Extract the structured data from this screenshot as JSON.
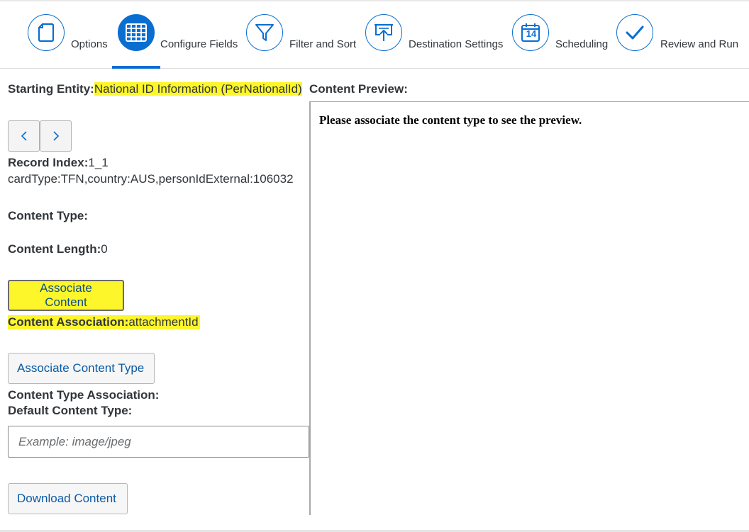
{
  "wizard": {
    "steps": [
      {
        "label": "Options",
        "icon": "document-icon"
      },
      {
        "label": "Configure Fields",
        "icon": "table-grid-icon",
        "active": true
      },
      {
        "label": "Filter and Sort",
        "icon": "filter-icon"
      },
      {
        "label": "Destination Settings",
        "icon": "upload-board-icon"
      },
      {
        "label": "Scheduling",
        "icon": "calendar-icon",
        "calendar_day": "14"
      },
      {
        "label": "Review and Run",
        "icon": "checkmark-icon"
      }
    ],
    "accent_color": "#0a6ed1"
  },
  "entity": {
    "label": "Starting Entity:",
    "value": "National ID Information (PerNationalId)"
  },
  "preview": {
    "title": "Content Preview:",
    "message": "Please associate the content type to see the preview."
  },
  "record": {
    "index_label": "Record Index:",
    "index_value": "1_1",
    "keys": "cardType:TFN,country:AUS,personIdExternal:106032"
  },
  "content_type": {
    "label": "Content Type:",
    "value": ""
  },
  "content_length": {
    "label": "Content Length:",
    "value": "0"
  },
  "buttons": {
    "associate_content": "Associate Content",
    "associate_content_type": "Associate Content Type",
    "download_content": "Download Content"
  },
  "content_association": {
    "label": "Content Association:",
    "value": "attachmentId"
  },
  "content_type_association": {
    "label": "Content Type Association:",
    "value": ""
  },
  "default_content_type": {
    "label": "Default Content Type:",
    "placeholder": "Example: image/jpeg"
  },
  "highlight_color": "#fdf62a"
}
